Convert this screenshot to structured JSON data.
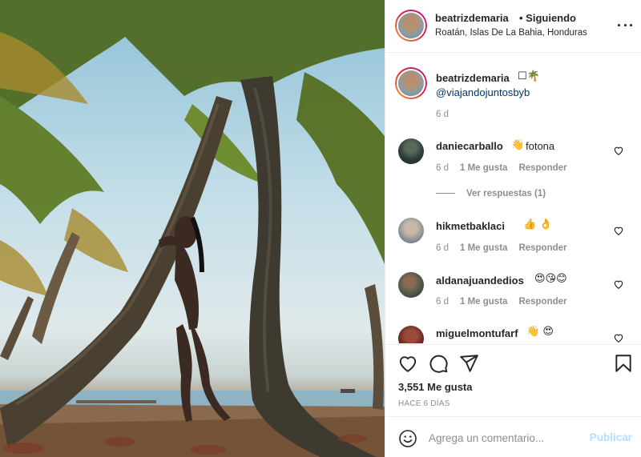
{
  "post": {
    "author": "beatrizdemaria",
    "follow_status": "• Siguiendo",
    "location": "Roatán, Islas De La Bahia, Honduras",
    "caption": {
      "username": "beatrizdemaria",
      "emoji": "☐🌴",
      "mention": "@viajandojuntosbyb",
      "time": "6 d"
    },
    "comments": [
      {
        "username": "daniecarballo",
        "text": "fotona",
        "emoji": "👋",
        "time": "6 d",
        "likes": "1 Me gusta",
        "reply": "Responder",
        "view_replies": "Ver respuestas (1)"
      },
      {
        "username": "hikmetbaklaci",
        "text": "",
        "emoji": "👍 👌",
        "time": "6 d",
        "likes": "1 Me gusta",
        "reply": "Responder"
      },
      {
        "username": "aldanajuandedios",
        "text": "",
        "emoji": "😍😘😊",
        "time": "6 d",
        "likes": "1 Me gusta",
        "reply": "Responder"
      },
      {
        "username": "miguelmontufarf",
        "text": "",
        "emoji": "👋 😍",
        "time": "",
        "likes": "",
        "reply": ""
      }
    ],
    "likes": "3,551 Me gusta",
    "posted_ago": "HACE 6 DÍAS",
    "compose": {
      "placeholder": "Agrega un comentario...",
      "publish": "Publicar"
    }
  },
  "icons": {
    "like": "heart-icon",
    "comment": "comment-icon",
    "share": "paper-plane-icon",
    "save": "bookmark-icon",
    "emoji": "smiley-icon",
    "more": "more-options-icon"
  },
  "colors": {
    "text": "#262626",
    "muted": "#8e8e8e",
    "mention": "#00376b",
    "publish_disabled": "#b2dffc",
    "border": "#efefef"
  }
}
